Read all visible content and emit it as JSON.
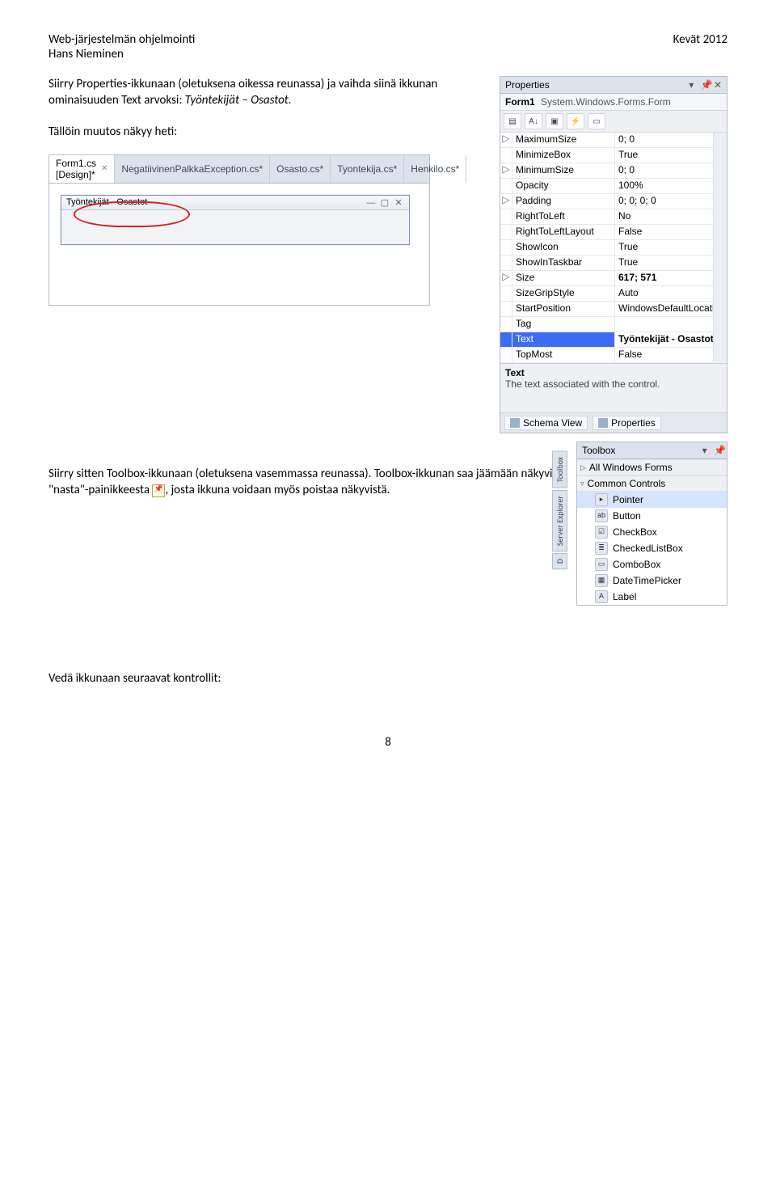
{
  "doc": {
    "header_left_line1": "Web-järjestelmän ohjelmointi",
    "header_left_line2": "Hans Nieminen",
    "header_right": "Kevät 2012",
    "para1a": "Siirry Properties-ikkunaan (oletuksena oikessa reunassa) ja vaihda siinä ikkunan ominaisuuden Text arvoksi: ",
    "para1b": "Työntekijät – Osastot.",
    "para2": "Tällöin muutos näkyy heti:",
    "para3a": "Siirry sitten Toolbox-ikkunaan (oletuksena vasemmassa reunassa). Toolbox-ikkunan saa jäämään näkyviin \"nasta\"-painikkeesta ",
    "para3b": ", josta ikkuna voidaan myös poistaa näkyvistä.",
    "para4": "Vedä ikkunaan seuraavat kontrollit:",
    "page_number": "8"
  },
  "properties_panel": {
    "title": "Properties",
    "object_name": "Form1",
    "object_type": "System.Windows.Forms.Form",
    "rows": [
      {
        "exp": "▷",
        "name": "MaximumSize",
        "value": "0; 0"
      },
      {
        "exp": "",
        "name": "MinimizeBox",
        "value": "True"
      },
      {
        "exp": "▷",
        "name": "MinimumSize",
        "value": "0; 0"
      },
      {
        "exp": "",
        "name": "Opacity",
        "value": "100%"
      },
      {
        "exp": "▷",
        "name": "Padding",
        "value": "0; 0; 0; 0"
      },
      {
        "exp": "",
        "name": "RightToLeft",
        "value": "No"
      },
      {
        "exp": "",
        "name": "RightToLeftLayout",
        "value": "False"
      },
      {
        "exp": "",
        "name": "ShowIcon",
        "value": "True"
      },
      {
        "exp": "",
        "name": "ShowInTaskbar",
        "value": "True"
      },
      {
        "exp": "▷",
        "name": "Size",
        "value": "617; 571",
        "bold": true
      },
      {
        "exp": "",
        "name": "SizeGripStyle",
        "value": "Auto"
      },
      {
        "exp": "",
        "name": "StartPosition",
        "value": "WindowsDefaultLocati"
      },
      {
        "exp": "",
        "name": "Tag",
        "value": ""
      },
      {
        "exp": "",
        "name": "Text",
        "value": "Työntekijät - Osastot",
        "selected": true,
        "bold": true
      },
      {
        "exp": "",
        "name": "TopMost",
        "value": "False"
      }
    ],
    "desc_title": "Text",
    "desc_text": "The text associated with the control.",
    "footer_schema": "Schema View",
    "footer_props": "Properties"
  },
  "designer": {
    "tabs": [
      {
        "label": "Form1.cs [Design]*",
        "active": true,
        "close": true
      },
      {
        "label": "NegatiivinenPalkkaException.cs*"
      },
      {
        "label": "Osasto.cs*"
      },
      {
        "label": "Tyontekija.cs*"
      },
      {
        "label": "Henkilo.cs*"
      }
    ],
    "form_title": "Työntekijät - Osastot"
  },
  "toolbox": {
    "title": "Toolbox",
    "groups": [
      {
        "label": "All Windows Forms",
        "open": false
      },
      {
        "label": "Common Controls",
        "open": true
      }
    ],
    "items": [
      {
        "icon": "▸",
        "label": "Pointer",
        "sel": true
      },
      {
        "icon": "ab",
        "label": "Button"
      },
      {
        "icon": "☑",
        "label": "CheckBox"
      },
      {
        "icon": "≣",
        "label": "CheckedListBox"
      },
      {
        "icon": "▭",
        "label": "ComboBox"
      },
      {
        "icon": "▦",
        "label": "DateTimePicker"
      },
      {
        "icon": "A",
        "label": "Label"
      }
    ],
    "side_tabs": [
      "Toolbox",
      "Server Explorer",
      "D"
    ]
  }
}
